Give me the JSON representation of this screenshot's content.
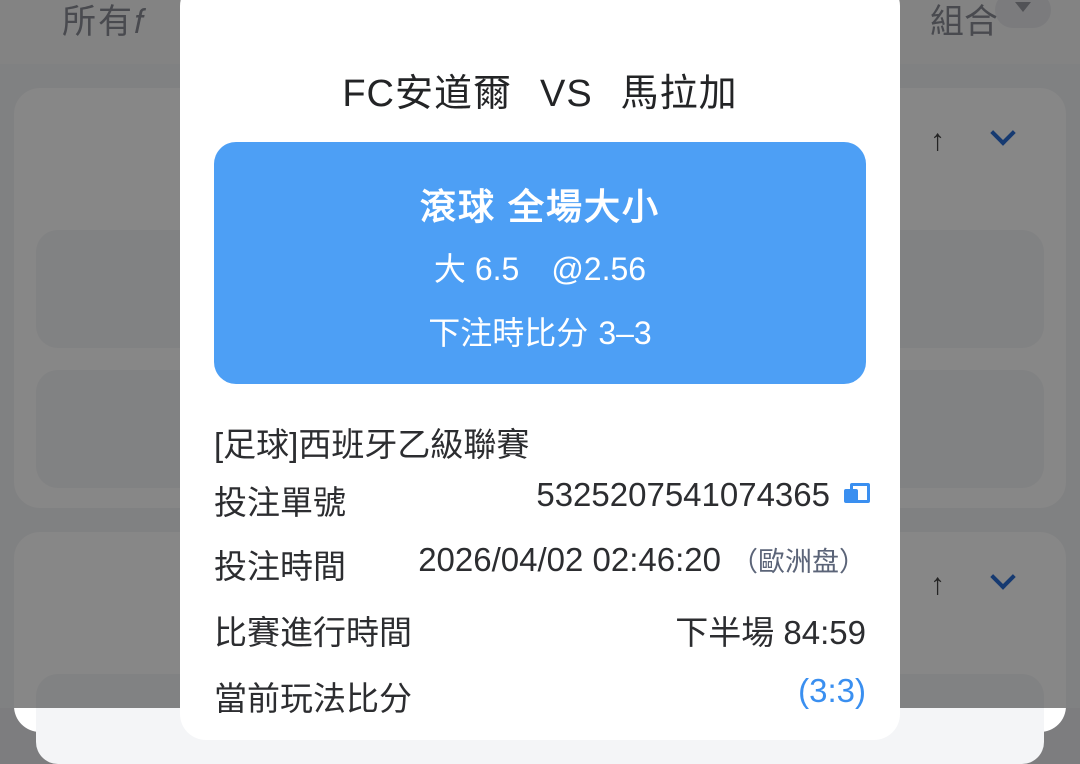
{
  "background": {
    "top_text_left": "所有𝑓",
    "top_text_right": "組合",
    "card_icon": "↑"
  },
  "modal": {
    "home_team": "FC安道爾",
    "vs": "VS",
    "away_team": "馬拉加",
    "bet": {
      "type": "滾球 全場大小",
      "selection": "大 6.5",
      "odds": "@2.56",
      "score_label": "下注時比分",
      "score": "3–3"
    },
    "league": "[足球]西班牙乙級聯賽",
    "details": {
      "bet_no_label": "投注單號",
      "bet_no": "5325207541074365",
      "bet_time_label": "投注時間",
      "bet_time": "2026/04/02 02:46:20",
      "bet_time_region": "（歐洲盘）",
      "match_time_label": "比賽進行時間",
      "match_time": "下半場 84:59",
      "current_score_label": "當前玩法比分",
      "current_score": "(3:3)"
    }
  },
  "colors": {
    "accent": "#4d9ff5",
    "link_blue": "#3a8ff0"
  }
}
